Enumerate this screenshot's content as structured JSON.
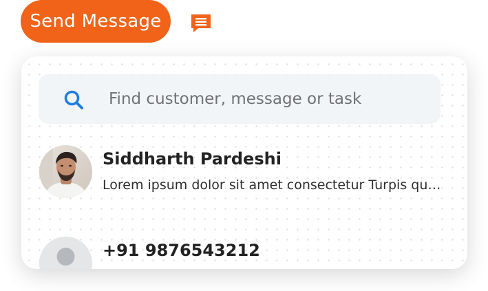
{
  "header": {
    "send_button_label": "Send Message",
    "message_icon": "chat-icon",
    "accent_color": "#f06318"
  },
  "search": {
    "placeholder": "Find customer, message or task",
    "value": "",
    "icon": "search-icon",
    "icon_color": "#1f7de0"
  },
  "contacts": [
    {
      "name": "Siddharth Pardeshi",
      "preview": "Lorem ipsum dolor sit amet consectetur Turpis quis sed",
      "avatar": "photo-avatar"
    },
    {
      "name": "+91 9876543212",
      "preview": "",
      "avatar": "default-user-avatar"
    }
  ]
}
